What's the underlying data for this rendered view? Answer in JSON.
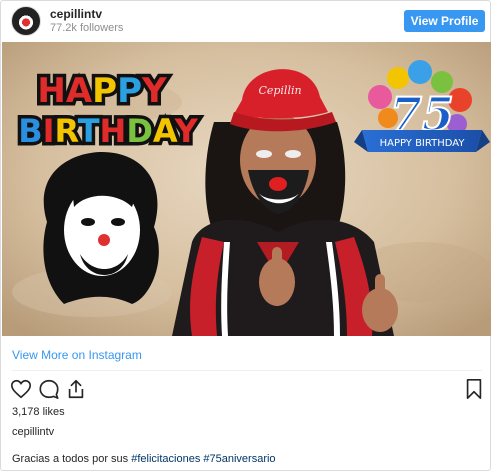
{
  "header": {
    "username": "cepillintv",
    "followers": "77.2k followers",
    "view_profile_label": "View Profile"
  },
  "photo": {
    "left_logo_text": "HAPPY BIRTHDAY",
    "badge_number": "75",
    "badge_text": "HAPPY BIRTHDAY",
    "cap_text": "Cepillin"
  },
  "view_more_label": "View More on Instagram",
  "actions": {
    "like_icon": "heart-icon",
    "comment_icon": "comment-icon",
    "share_icon": "share-icon",
    "save_icon": "bookmark-icon"
  },
  "likes": "3,178 likes",
  "owner": "cepillintv",
  "caption": {
    "text": "Gracias a todos por sus ",
    "tag1": "#felicitaciones",
    "space": " ",
    "tag2": "#75aniversario"
  },
  "colors": {
    "accent": "#3897f0",
    "hashtag": "#003569",
    "cap_red": "#d8202a"
  }
}
